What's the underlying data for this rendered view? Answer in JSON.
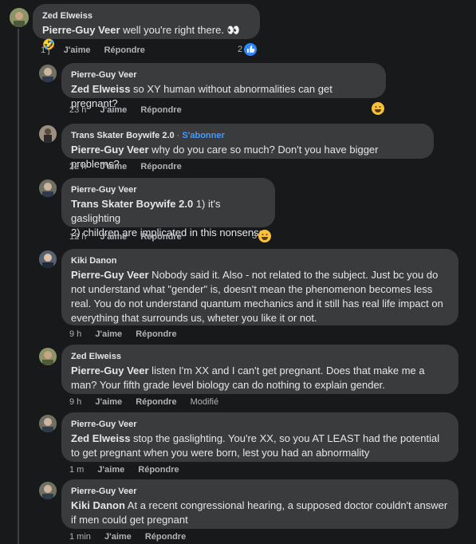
{
  "comments": [
    {
      "author": "Zed Elweiss",
      "mention": "Pierre-Guy Veer",
      "text": " well you're right there. 👀🤣",
      "time": "1 j",
      "like": "J'aime",
      "reply": "Répondre",
      "reaction_count": "2"
    },
    {
      "author": "Pierre-Guy Veer",
      "mention": "Zed Elweiss",
      "text": " so XY human without abnormalities can get pregnant?",
      "time": "23 h",
      "like": "J'aime",
      "reply": "Répondre"
    },
    {
      "author": "Trans Skater Boywife 2.0",
      "follow": "S'abonner",
      "mention": "Pierre-Guy Veer",
      "text": " why do you care so much? Don't you have bigger problems?",
      "time": "22 h",
      "like": "J'aime",
      "reply": "Répondre"
    },
    {
      "author": "Pierre-Guy Veer",
      "mention": "Trans Skater Boywife 2.0",
      "text": " 1) it's gaslighting",
      "text2": "2) children are implicated in this nonsense",
      "time": "12 h",
      "like": "J'aime",
      "reply": "Répondre",
      "reaction_count": "3"
    },
    {
      "author": "Kiki Danon",
      "mention": "Pierre-Guy Veer",
      "text": " Nobody said it. Also - not related to the subject. Just bc you do not understand what \"gender\" is, doesn't mean the phenomenon becomes less real. You do not understand quantum mechanics and it still has real life impact on everything that surrounds us, wheter you like it or not.",
      "time": "9 h",
      "like": "J'aime",
      "reply": "Répondre"
    },
    {
      "author": "Zed Elweiss",
      "mention": "Pierre-Guy Veer",
      "text": " listen I'm XX and I can't get pregnant. Does that make me a man? Your fifth grade level biology can do nothing to explain gender.",
      "time": "9 h",
      "like": "J'aime",
      "reply": "Répondre",
      "edited": "Modifié"
    },
    {
      "author": "Pierre-Guy Veer",
      "mention": "Zed Elweiss",
      "text": " stop the gaslighting. You're XX, so you AT LEAST had the potential to get pregnant when you were born, lest you had an abnormality",
      "time": "1 m",
      "like": "J'aime",
      "reply": "Répondre"
    },
    {
      "author": "Pierre-Guy Veer",
      "mention": "Kiki Danon",
      "text": " At a recent congressional hearing, a supposed doctor couldn't answer if men could get pregnant",
      "time": "1 min",
      "like": "J'aime",
      "reply": "Répondre"
    }
  ],
  "colors": {
    "background": "#18191a",
    "bubble": "#3a3b3c",
    "text": "#e4e6eb",
    "muted": "#b0b3b8",
    "link": "#4599ff",
    "like": "#2d88ff",
    "haha": "#f7c13a"
  }
}
